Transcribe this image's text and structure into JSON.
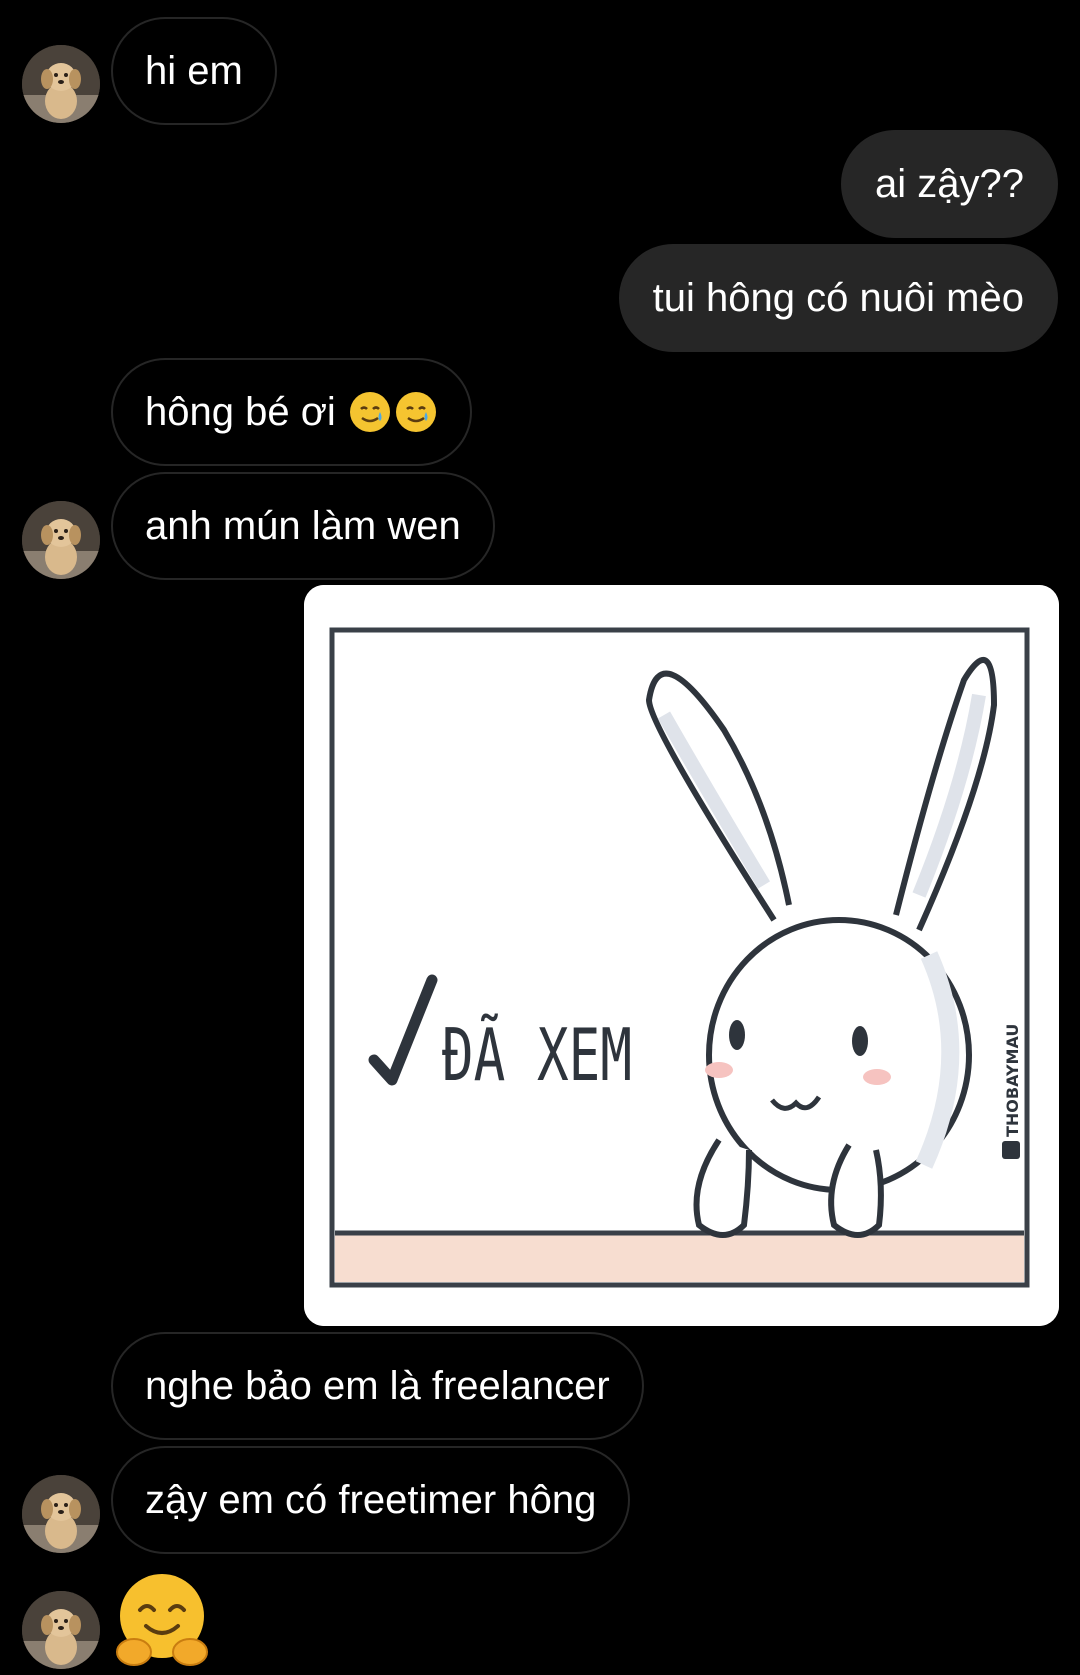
{
  "chat": {
    "messages": [
      {
        "sender": "other",
        "text": "hi em"
      },
      {
        "sender": "me",
        "text": "ai zậy??"
      },
      {
        "sender": "me",
        "text": "tui hông có nuôi mèo"
      },
      {
        "sender": "other",
        "text": "hông bé ơi",
        "emojis": [
          "smiling-face-with-tear-icon",
          "smiling-face-with-tear-icon"
        ]
      },
      {
        "sender": "other",
        "text": "anh mún làm wen"
      },
      {
        "sender": "other",
        "type": "sticker",
        "sticker_text": "ĐÃ XEM",
        "watermark": "THOBAYMAU"
      },
      {
        "sender": "other",
        "text": "nghe bảo em là freelancer"
      },
      {
        "sender": "other",
        "text": "zậy em có freetimer hông"
      },
      {
        "sender": "other",
        "type": "emoji",
        "emoji": "hugging-face-icon"
      }
    ]
  },
  "colors": {
    "background": "#000000",
    "outgoing_bubble": "#262626",
    "incoming_border": "#262626",
    "text": "#ffffff"
  }
}
